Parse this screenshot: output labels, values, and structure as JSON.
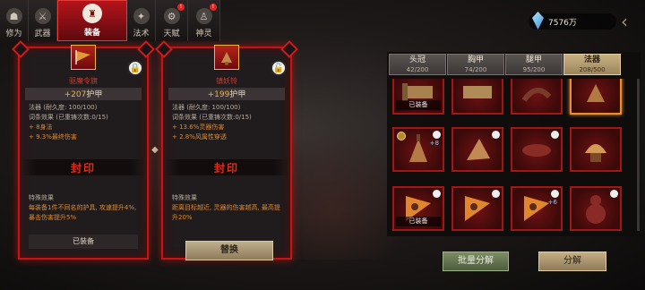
{
  "nav": {
    "tabs": [
      {
        "label": "修为",
        "icon": "figure-icon"
      },
      {
        "label": "武器",
        "icon": "sword-icon"
      },
      {
        "label": "装备",
        "icon": "robe-icon"
      },
      {
        "label": "法术",
        "icon": "spell-icon"
      },
      {
        "label": "天赋",
        "icon": "gear-icon"
      },
      {
        "label": "神灵",
        "icon": "idol-icon"
      }
    ]
  },
  "currency": {
    "amount": "7576万"
  },
  "left_card": {
    "name": "驱魔令旗",
    "stat_value": "+207",
    "stat_label": "护甲",
    "line1": "法器 (耐久度: 100/100)",
    "line2": "词条效果 (已重铸次数:0/15)",
    "bonus1": "+ 8身法",
    "bonus2": "+ 9.3%最终伤害",
    "seal": "封印",
    "special_title": "特殊效果",
    "special_text": "每装备1件不同名的护具, 攻速提升4%, 暴击伤害提升5%",
    "status": "已装备"
  },
  "right_card": {
    "name": "镇妖铃",
    "stat_value": "+199",
    "stat_label": "护甲",
    "line1": "法器 (耐久度: 100/100)",
    "line2": "词条效果 (已重铸次数:0/15)",
    "bonus1": "+ 13.6%灵器伤害",
    "bonus2": "+ 2.8%风属性穿透",
    "seal": "封印",
    "special_title": "特殊效果",
    "special_text": "距离目标越近, 灵器的伤害越高, 最高提升20%",
    "action": "替换"
  },
  "inventory_tabs": [
    {
      "label": "头冠",
      "count": "42/200"
    },
    {
      "label": "胸甲",
      "count": "74/200"
    },
    {
      "label": "腿甲",
      "count": "95/200"
    },
    {
      "label": "法器",
      "count": "208/500"
    }
  ],
  "inventory": {
    "equipped_label": "已装备",
    "cell_levels": [
      "+5",
      "+8",
      "+6"
    ]
  },
  "buttons": {
    "batch_decompose": "批量分解",
    "decompose": "分解"
  },
  "colors": {
    "accent_red": "#c51414",
    "gold": "#c4ae84",
    "green_button": "#6b7d55"
  }
}
